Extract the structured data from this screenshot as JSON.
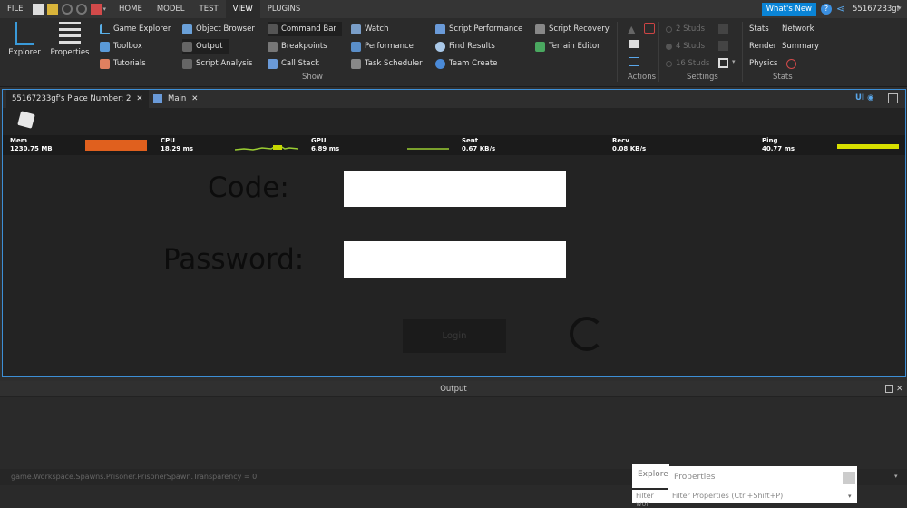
{
  "menubar": {
    "file": "FILE",
    "tabs": [
      "HOME",
      "MODEL",
      "TEST",
      "VIEW",
      "PLUGINS"
    ],
    "active_tab": "VIEW",
    "whats_new": "What's New",
    "username": "55167233gf"
  },
  "ribbon": {
    "explorer": "Explorer",
    "properties": "Properties",
    "col1": [
      "Game Explorer",
      "Toolbox",
      "Tutorials"
    ],
    "col2": [
      "Object Browser",
      "Output",
      "Script Analysis"
    ],
    "col3": [
      "Command Bar",
      "Breakpoints",
      "Call Stack"
    ],
    "col4": [
      "Watch",
      "Performance",
      "Task Scheduler"
    ],
    "col5": [
      "Script Performance",
      "Find Results",
      "Team Create"
    ],
    "col6": [
      "Script Recovery",
      "Terrain Editor"
    ],
    "group_show": "Show",
    "group_actions": "Actions",
    "studs": [
      "2 Studs",
      "4 Studs",
      "16 Studs"
    ],
    "group_settings": "Settings",
    "stats_left": [
      "Stats",
      "Render",
      "Physics"
    ],
    "stats_right": [
      "Network",
      "Summary"
    ],
    "group_stats": "Stats"
  },
  "viewport": {
    "tab1": "55167233gf's Place Number: 2",
    "tab2": "Main",
    "ui_toggle": "UI"
  },
  "stats": {
    "mem_label": "Mem",
    "mem_value": "1230.75 MB",
    "cpu_label": "CPU",
    "cpu_value": "18.29 ms",
    "gpu_label": "GPU",
    "gpu_value": "6.89 ms",
    "sent_label": "Sent",
    "sent_value": "0.67 KB/s",
    "recv_label": "Recv",
    "recv_value": "0.08 KB/s",
    "ping_label": "Ping",
    "ping_value": "40.77 ms"
  },
  "game": {
    "code_label": "Code:",
    "password_label": "Password:",
    "login_button": "Login"
  },
  "output": {
    "title": "Output",
    "command_text": "game.Workspace.Spawns.Prisoner.PrisonerSpawn.Transparency = 0",
    "explorer_tab": "Explore",
    "properties_tab": "Properties",
    "explorer_filter": "Filter wor",
    "properties_filter": "Filter Properties (Ctrl+Shift+P)"
  },
  "colors": {
    "accent": "#0a84d6",
    "mem_bar": "#e0601e",
    "ping_bar": "#d8e000",
    "graph": "#9acd32"
  }
}
